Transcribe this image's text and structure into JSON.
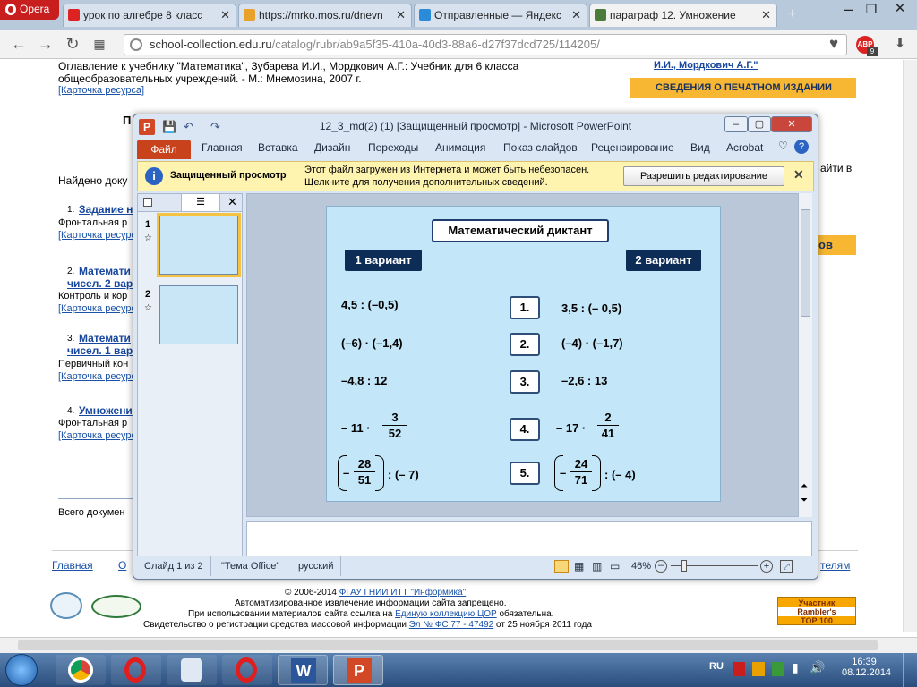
{
  "browser": {
    "menu_label": "Opera",
    "tabs": [
      {
        "label": "урок по алгебре 8 класс"
      },
      {
        "label": "https://mrko.mos.ru/dnevn"
      },
      {
        "label": "Отправленные — Яндекс"
      },
      {
        "label": "параграф 12. Умножение"
      }
    ],
    "url_host": "school-collection.edu.ru",
    "url_path": "/catalog/rubr/ab9a5f35-410a-40d3-88a6-d27f37dcd725/114205/",
    "abp_label": "ABP",
    "abp_badge": "9"
  },
  "webpage": {
    "book_ref": "Оглавление к учебнику \"Математика\", Зубарева И.И., Мордкович А.Г.: Учебник для 6 класса",
    "book_ref2": "общеобразовательных учреждений. - М.: Мнемозина, 2007 г.",
    "resource_card": "[Карточка ресурса]",
    "found": "Найдено доку",
    "p_heading": "П",
    "items": [
      {
        "n": "1.",
        "title": "Задание н",
        "desc": "Фронтальная р"
      },
      {
        "n": "2.",
        "title": "Математи",
        "title2": "чисел. 2 вар",
        "desc": "Контроль и кор"
      },
      {
        "n": "3.",
        "title": "Математи",
        "title2": "чисел. 1 вар",
        "desc": "Первичный кон"
      },
      {
        "n": "4.",
        "title": "Умножени",
        "desc": "Фронтальная р"
      }
    ],
    "total": "Всего докумен",
    "right_authors": "И.И., Мордкович А.Г.\"",
    "right_orange1": "СВЕДЕНИЯ О ПЕЧАТНОМ ИЗДАНИИ",
    "right_orange2": "ов",
    "right_text": "айти в",
    "nav_main": "Главная",
    "nav_o": "О",
    "nav_right": "телям",
    "footer_line1": "© 2006-2014",
    "footer_org": "ФГАУ ГНИИ ИТТ \"Информика\"",
    "footer_line2": "Автоматизированное извлечение информации сайта запрещено.",
    "footer_line3a": "При использовании материалов сайта ссылка на",
    "footer_line3_link": "Единую коллекцию ЦОР",
    "footer_line3b": "обязательна.",
    "footer_line4a": "Свидетельство о регистрации средства массовой информации",
    "footer_line4_link": "Эл № ФС 77 - 47492",
    "footer_line4b": "от 25 ноября 2011 года",
    "rambler_1": "Участник",
    "rambler_2": "Rambler's",
    "rambler_3": "TOP 100"
  },
  "ppt": {
    "title": "12_3_md(2) (1) [Защищенный просмотр] - Microsoft PowerPoint",
    "logo": "P",
    "ribbon_tabs": [
      "Файл",
      "Главная",
      "Вставка",
      "Дизайн",
      "Переходы",
      "Анимация",
      "Показ слайдов",
      "Рецензирование",
      "Вид",
      "Acrobat"
    ],
    "msg_title": "Защищенный просмотр",
    "msg_text1": "Этот файл загружен из Интернета и может быть небезопасен.",
    "msg_text2": "Щелкните для получения дополнительных сведений.",
    "msg_button": "Разрешить редактирование",
    "thumb_nums": [
      "1",
      "2"
    ],
    "status_slide": "Слайд 1 из 2",
    "status_theme": "\"Тема Office\"",
    "status_lang": "русский",
    "zoom": "46%"
  },
  "slide": {
    "title": "Математический диктант",
    "variant1": "1 вариант",
    "variant2": "2 вариант",
    "nums": [
      "1.",
      "2.",
      "3.",
      "4.",
      "5."
    ],
    "left": [
      "4,5 : (–0,5)",
      "(–6) · (–1,4)",
      "–4,8 : 12"
    ],
    "right": [
      "3,5 : (– 0,5)",
      "(–4) · (–1,7)",
      "–2,6  : 13"
    ],
    "l4_pre": "– 11 ·",
    "l4_num": "3",
    "l4_den": "52",
    "r4_pre": "– 17 ·",
    "r4_num": "2",
    "r4_den": "41",
    "l5_sign": "–",
    "l5_num": "28",
    "l5_den": "51",
    "l5_post": ": (– 7)",
    "r5_sign": "–",
    "r5_num": "24",
    "r5_den": "71",
    "r5_post": ": (– 4)"
  },
  "taskbar": {
    "time": "16:39",
    "date": "08.12.2014",
    "lang": "RU"
  }
}
